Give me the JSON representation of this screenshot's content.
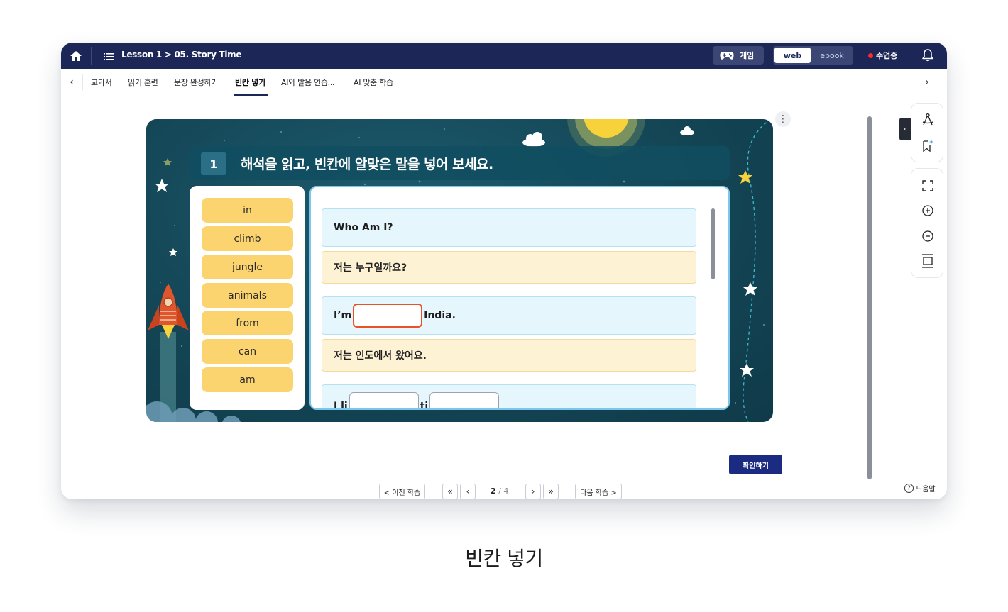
{
  "topbar": {
    "breadcrumb": "Lesson 1 > 05. Story Time",
    "game_label": "게임",
    "mode_web": "web",
    "mode_ebook": "ebook",
    "live_label": "수업중"
  },
  "tabs": [
    {
      "label": "교과서"
    },
    {
      "label": "읽기 훈련"
    },
    {
      "label": "문장 완성하기"
    },
    {
      "label": "빈칸 넣기"
    },
    {
      "label": "AI와 발음 연습..."
    },
    {
      "label": "AI 맞춤 학습"
    }
  ],
  "active_tab": "빈칸 넣기",
  "question": {
    "number": "1",
    "text": "해석을 읽고, 빈칸에 알맞은 말을 넣어 보세요."
  },
  "word_bank": [
    "in",
    "climb",
    "jungle",
    "animals",
    "from",
    "can",
    "am"
  ],
  "sentences": {
    "s1_en": "Who Am I?",
    "s1_ko": "저는 누구일까요?",
    "s2_en_before": "I’m",
    "s2_en_after": "India.",
    "s2_ko": "저는 인도에서 왔어요.",
    "s3_en_before": "I li",
    "s3_en_mid": "ti"
  },
  "actions": {
    "confirm": "확인하기",
    "prev": "< 이전 학습",
    "next": "다음 학습 >",
    "first": "«",
    "prev_page": "‹",
    "next_page": "›",
    "last": "»",
    "help": "도움말",
    "help_mark": "?"
  },
  "pagination": {
    "current": "2",
    "sep": "/",
    "total": "4"
  },
  "caption": "빈칸 넣기",
  "colors": {
    "navy": "#1c2758",
    "stage_teal": "#144656",
    "word_yellow": "#fbd46f",
    "blank_border": "#e8512a",
    "confirm_blue": "#1c2b82"
  },
  "icons": {
    "home": "home-icon",
    "menu": "list-icon",
    "game": "gamepad-icon",
    "bell": "bell-icon",
    "tools": [
      "compass-icon",
      "bookmark-sparkle-icon",
      "fullscreen-icon",
      "zoom-in-icon",
      "zoom-out-icon",
      "fit-height-icon"
    ]
  }
}
